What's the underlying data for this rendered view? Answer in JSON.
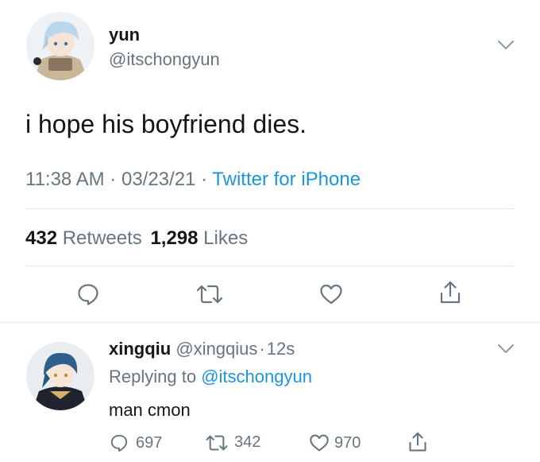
{
  "main_tweet": {
    "display_name": "yun",
    "handle": "@itschongyun",
    "text": "i hope his boyfriend dies.",
    "time": "11:38 AM",
    "date": "03/23/21",
    "separator": "·",
    "source": "Twitter for iPhone",
    "retweets_count": "432",
    "retweets_label": "Retweets",
    "likes_count": "1,298",
    "likes_label": "Likes"
  },
  "reply": {
    "display_name": "xingqiu",
    "handle": "@xingqius",
    "separator": "·",
    "time": "12s",
    "replying_prefix": "Replying to",
    "replying_to": "@itschongyun",
    "text": "man cmon",
    "reply_count": "697",
    "retweet_count": "342",
    "like_count": "970"
  },
  "colors": {
    "link": "#1b95e0",
    "secondary_text": "#66757f",
    "divider": "#e1e8ed"
  },
  "icons": [
    "chevron-down-icon",
    "reply-icon",
    "retweet-icon",
    "like-icon",
    "share-icon"
  ]
}
